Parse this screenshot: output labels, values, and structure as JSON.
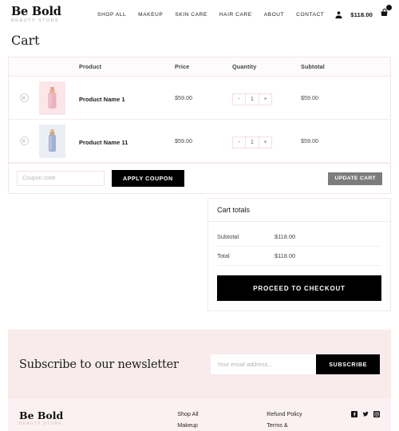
{
  "header": {
    "logo": {
      "name": "Be Bold",
      "tagline": "BEAUTY STORE"
    },
    "nav": [
      {
        "label": "SHOP ALL"
      },
      {
        "label": "MAKEUP"
      },
      {
        "label": "SKIN CARE"
      },
      {
        "label": "HAIR CARE"
      },
      {
        "label": "ABOUT"
      },
      {
        "label": "CONTACT"
      }
    ],
    "account_icon": "user-icon",
    "cart_total": "$118.00",
    "cart_icon": "shopping-bag-icon"
  },
  "page": {
    "title": "Cart"
  },
  "cart_table": {
    "columns": [
      "Product",
      "Price",
      "Quantity",
      "Subtotal"
    ],
    "rows": [
      {
        "remove_icon": "remove-circle-icon",
        "thumb": "product-bottle-pink",
        "name": "Product Name 1",
        "price": "$59.00",
        "qty_minus": "-",
        "qty": "1",
        "qty_plus": "+",
        "subtotal": "$59.00"
      },
      {
        "remove_icon": "remove-circle-icon",
        "thumb": "product-bottle-blue",
        "name": "Product Name 11",
        "price": "$59.00",
        "qty_minus": "-",
        "qty": "1",
        "qty_plus": "+",
        "subtotal": "$59.00"
      }
    ],
    "coupon_placeholder": "Coupon code",
    "coupon_value": "",
    "apply_coupon_label": "APPLY COUPON",
    "update_cart_label": "UPDATE CART"
  },
  "totals": {
    "heading": "Cart totals",
    "subtotal_label": "Subtotal",
    "subtotal_value": "$118.00",
    "total_label": "Total",
    "total_value": "$118.00",
    "checkout_label": "PROCEED TO CHECKOUT"
  },
  "newsletter": {
    "title": "Subscribe to our newsletter",
    "email_placeholder": "Your email address...",
    "email_value": "",
    "subscribe_label": "SUBSCRIBE"
  },
  "footer": {
    "logo": {
      "name": "Be Bold",
      "tagline": "BEAUTY STORE"
    },
    "col1": [
      {
        "label": "Shop All"
      },
      {
        "label": "Makeup"
      }
    ],
    "col2": [
      {
        "label": "Refund Policy"
      },
      {
        "label": "Terms &"
      }
    ],
    "socials": [
      {
        "name": "facebook-icon"
      },
      {
        "name": "twitter-icon"
      },
      {
        "name": "instagram-icon"
      }
    ]
  },
  "colors": {
    "accent_dark": "#000000",
    "pink_bg": "#f8ebec",
    "footer_bg": "#fbf1f2",
    "border_pink": "#f1e7e9",
    "disabled_gray": "#7c7c7c"
  }
}
